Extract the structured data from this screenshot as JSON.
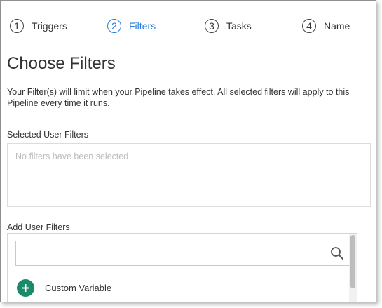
{
  "wizard": {
    "steps": [
      {
        "number": "1",
        "label": "Triggers",
        "active": false
      },
      {
        "number": "2",
        "label": "Filters",
        "active": true
      },
      {
        "number": "3",
        "label": "Tasks",
        "active": false
      },
      {
        "number": "4",
        "label": "Name",
        "active": false
      }
    ]
  },
  "page": {
    "title": "Choose Filters",
    "description": "Your Filter(s) will limit when your Pipeline takes effect. All selected filters will apply to this Pipeline every time it runs."
  },
  "selected": {
    "label": "Selected User Filters",
    "empty_text": "No filters have been selected"
  },
  "add": {
    "label": "Add User Filters",
    "search_value": "",
    "items": [
      {
        "label": "Custom Variable",
        "icon": "plus-icon"
      }
    ]
  },
  "colors": {
    "active_step": "#2a7bd8",
    "add_icon_bg": "#1b8a6b",
    "placeholder_text": "#bdbdbd"
  }
}
